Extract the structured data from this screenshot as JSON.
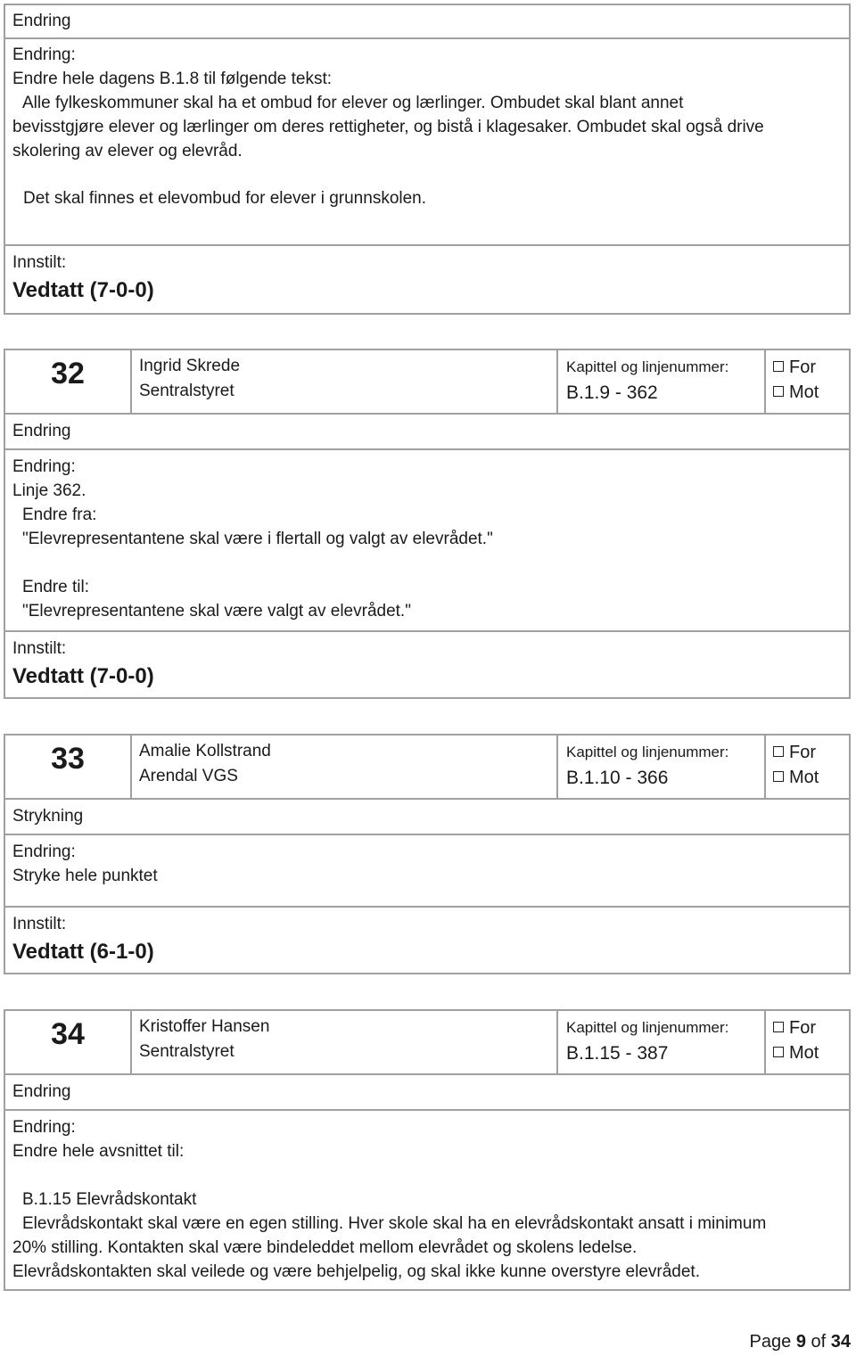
{
  "block_top": {
    "type": "Endring",
    "change_label": "Endring:",
    "change_lines": [
      "Endre hele dagens B.1.8 til følgende tekst:",
      "",
      "Alle fylkeskommuner skal ha et ombud for elever og lærlinger. Ombudet skal blant annet",
      "bevisstgjøre elever og lærlinger om deres rettigheter, og bistå i klagesaker. Ombudet skal også drive",
      "skolering av elever og elevråd.",
      "",
      "Det skal finnes et elevombud for elever i grunnskolen."
    ],
    "recommendation_label": "Innstilt:",
    "recommendation": "Vedtatt (7-0-0)"
  },
  "proposals": [
    {
      "number": "32",
      "author": "Ingrid Skrede",
      "organization": "Sentralstyret",
      "chapter_label": "Kapittel og linjenummer:",
      "chapter": "B.1.9 - 362",
      "vote_for": "For",
      "vote_against": "Mot",
      "type": "Endring",
      "change_label": "Endring:",
      "change_lines": [
        "Linje 362.",
        "Endre fra:",
        "\"Elevrepresentantene skal være i flertall og valgt av elevrådet.\"",
        "",
        "Endre til:",
        "\"Elevrepresentantene skal være valgt av elevrådet.\""
      ],
      "recommendation_label": "Innstilt:",
      "recommendation": "Vedtatt (7-0-0)"
    },
    {
      "number": "33",
      "author": "Amalie Kollstrand",
      "organization": "Arendal VGS",
      "chapter_label": "Kapittel og linjenummer:",
      "chapter": "B.1.10 - 366",
      "vote_for": "For",
      "vote_against": "Mot",
      "type": "Strykning",
      "change_label": "Endring:",
      "change_lines": [
        "Stryke hele punktet"
      ],
      "recommendation_label": "Innstilt:",
      "recommendation": "Vedtatt (6-1-0)"
    },
    {
      "number": "34",
      "author": "Kristoffer Hansen",
      "organization": "Sentralstyret",
      "chapter_label": "Kapittel og linjenummer:",
      "chapter": "B.1.15 - 387",
      "vote_for": "For",
      "vote_against": "Mot",
      "type": "Endring",
      "change_label": "Endring:",
      "change_lines": [
        "Endre hele avsnittet til:",
        "",
        "B.1.15 Elevrådskontakt",
        "Elevrådskontakt skal være en egen stilling. Hver skole skal ha en elevrådskontakt ansatt i minimum",
        "20% stilling. Kontakten skal være bindeleddet mellom elevrådet og skolens ledelse.",
        "Elevrådskontakten skal veilede og være behjelpelig, og skal ikke kunne overstyre elevrådet."
      ]
    }
  ],
  "footer": {
    "page_label": "Page",
    "page": "9",
    "of_label": "of",
    "total": "34"
  }
}
